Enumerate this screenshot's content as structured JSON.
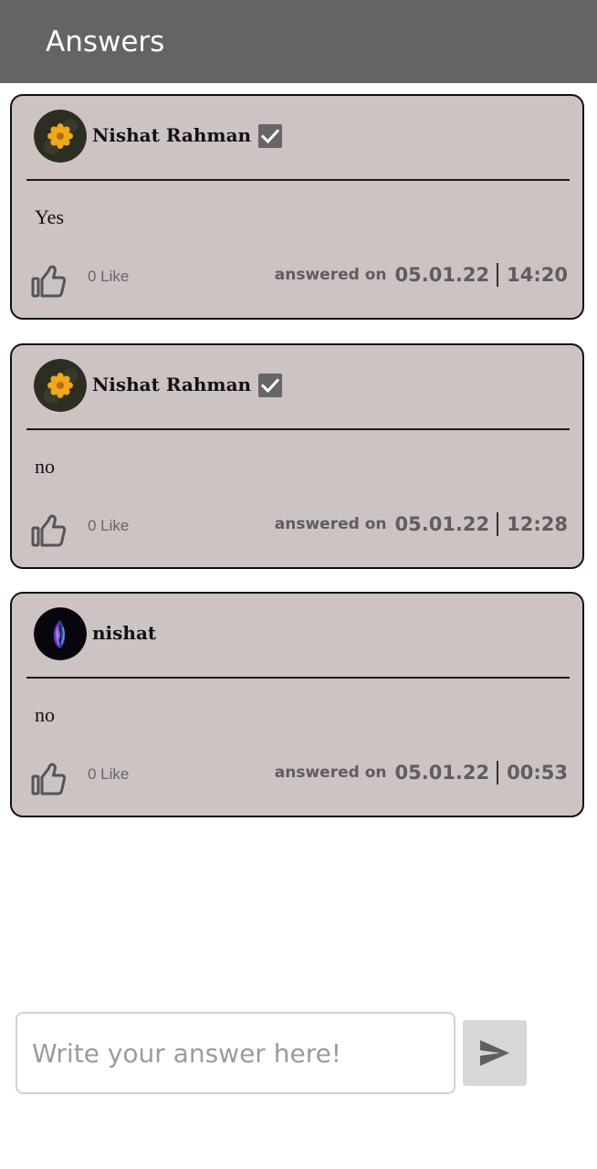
{
  "appbar": {
    "title": "Answers"
  },
  "colors": {
    "appbar_bg": "#646464",
    "card_bg": "#cdc3c2",
    "card_border": "#111111",
    "meta_text": "#5e5e5e",
    "send_bg": "#d6d7d6"
  },
  "answers": [
    {
      "author": "Nishat Rahman",
      "verified": true,
      "avatar_icon": "yellow-flower-avatar",
      "text": "Yes",
      "likes": "0 Like",
      "answered_label": "answered on",
      "date": "05.01.22",
      "time": "14:20"
    },
    {
      "author": "Nishat Rahman",
      "verified": true,
      "avatar_icon": "yellow-flower-avatar",
      "text": "no",
      "likes": "0 Like",
      "answered_label": "answered on",
      "date": "05.01.22",
      "time": "12:28"
    },
    {
      "author": "nishat",
      "verified": false,
      "avatar_icon": "purple-butterfly-avatar",
      "text": "no",
      "likes": "0 Like",
      "answered_label": "answered on",
      "date": "05.01.22",
      "time": "00:53"
    }
  ],
  "composer": {
    "placeholder": "Write your answer here!",
    "value": "",
    "send_icon": "send-icon"
  }
}
